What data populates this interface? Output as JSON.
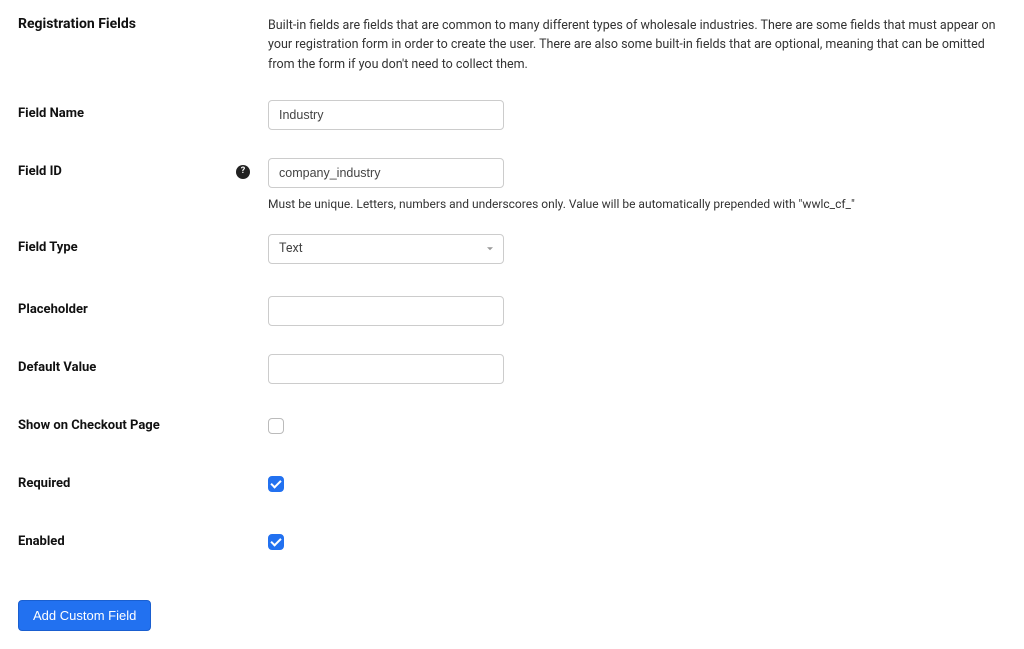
{
  "section": {
    "title": "Registration Fields",
    "description": "Built-in fields are fields that are common to many different types of wholesale industries. There are some fields that must appear on your registration form in order to create the user. There are also some built-in fields that are optional, meaning that can be omitted from the form if you don't need to collect them."
  },
  "labels": {
    "field_name": "Field Name",
    "field_id": "Field ID",
    "field_type": "Field Type",
    "placeholder": "Placeholder",
    "default_value": "Default Value",
    "show_on_checkout": "Show on Checkout Page",
    "required": "Required",
    "enabled": "Enabled"
  },
  "values": {
    "field_name": "Industry",
    "field_id": "company_industry",
    "field_type": "Text",
    "placeholder": "",
    "default_value": "",
    "show_on_checkout": false,
    "required": true,
    "enabled": true
  },
  "hints": {
    "field_id": "Must be unique. Letters, numbers and underscores only. Value will be automatically prepended with \"wwlc_cf_\""
  },
  "buttons": {
    "add_custom_field": "Add Custom Field"
  },
  "icons": {
    "help": "?"
  }
}
